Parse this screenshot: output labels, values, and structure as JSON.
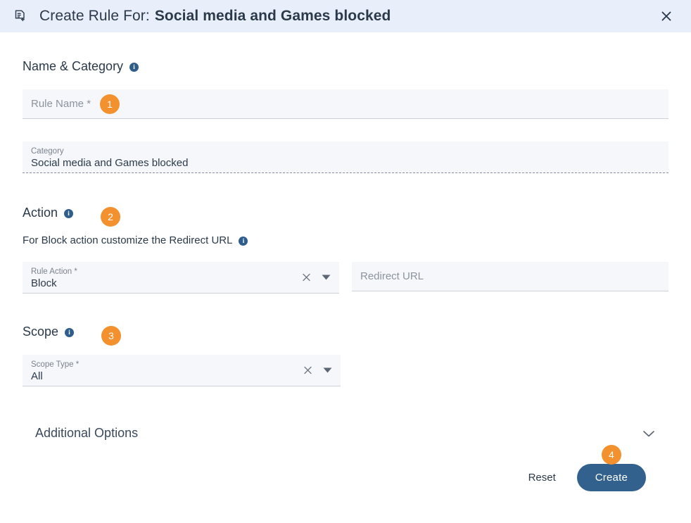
{
  "header": {
    "icon": "note-add-icon",
    "title_prefix": "Create Rule For:",
    "title_name": "Social media and Games blocked",
    "close_label": "✕",
    "background_color": "#e9eefb"
  },
  "sections": {
    "name_category": {
      "title": "Name & Category",
      "info_icon": "info-icon",
      "info_glyph": "i",
      "rule_name": {
        "label": "Rule Name *",
        "placeholder": "Rule Name *",
        "value": ""
      },
      "category": {
        "label": "Category",
        "value": "Social media and Games blocked",
        "disabled": true
      }
    },
    "action": {
      "title": "Action",
      "info_glyph": "i",
      "hint": "For Block action customize the Redirect URL",
      "rule_action": {
        "label": "Rule Action *",
        "value": "Block",
        "clear_icon": "clear-x-icon",
        "dropdown_icon": "chevron-down-icon"
      },
      "redirect_url": {
        "placeholder": "Redirect URL",
        "value": ""
      }
    },
    "scope": {
      "title": "Scope",
      "info_glyph": "i",
      "scope_type": {
        "label": "Scope Type *",
        "value": "All",
        "clear_icon": "clear-x-icon",
        "dropdown_icon": "chevron-down-icon"
      }
    },
    "additional_options": {
      "title": "Additional Options",
      "expand_icon": "chevron-down-icon",
      "expanded": false
    }
  },
  "footer": {
    "reset_label": "Reset",
    "create_label": "Create",
    "create_color": "#33618e"
  },
  "step_badges": [
    {
      "number": "1",
      "target": "rule-name-field"
    },
    {
      "number": "2",
      "target": "action-section"
    },
    {
      "number": "3",
      "target": "scope-section"
    },
    {
      "number": "4",
      "target": "create-button"
    }
  ],
  "colors": {
    "badge_orange": "#f2912e",
    "info_blue": "#2f5d8c",
    "header_blue": "#e9eefb",
    "field_bg": "#f6f7fa",
    "text_dark": "#2b3a4a"
  }
}
